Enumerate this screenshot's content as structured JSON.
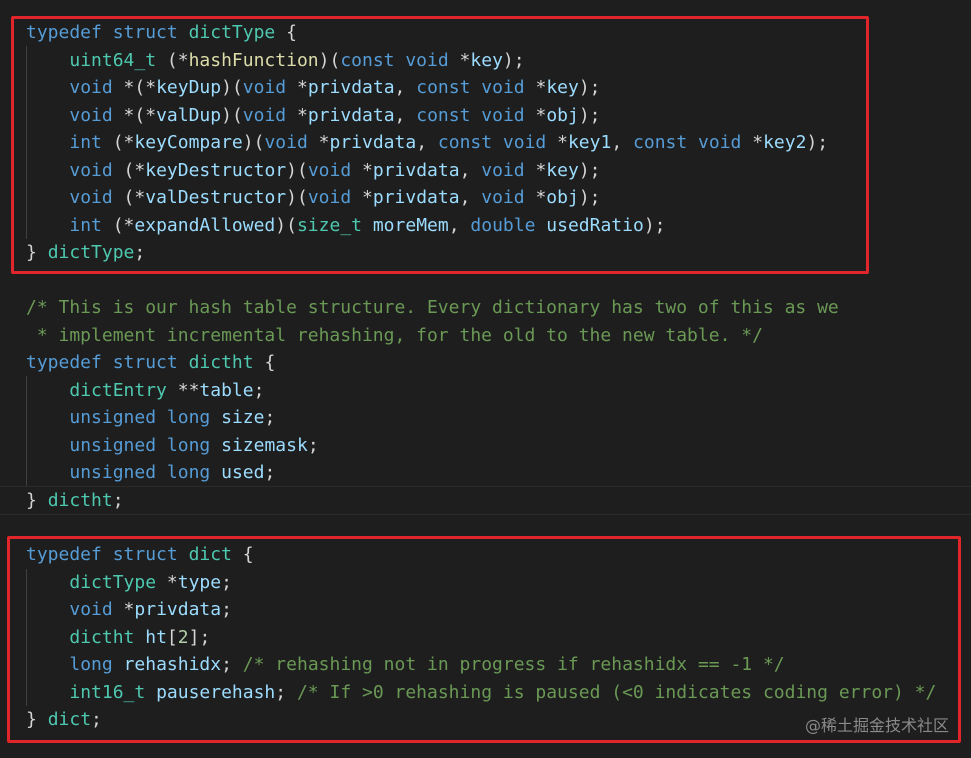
{
  "code": {
    "block1": [
      [
        [
          "kw",
          "typedef"
        ],
        [
          "p",
          " "
        ],
        [
          "kw",
          "struct"
        ],
        [
          "p",
          " "
        ],
        [
          "ty",
          "dictType"
        ],
        [
          "p",
          " {"
        ]
      ],
      [
        [
          "p",
          "    "
        ],
        [
          "ty",
          "uint64_t"
        ],
        [
          "p",
          " (*"
        ],
        [
          "fn",
          "hashFunction"
        ],
        [
          "p",
          ")("
        ],
        [
          "kw",
          "const"
        ],
        [
          "p",
          " "
        ],
        [
          "kw",
          "void"
        ],
        [
          "p",
          " *"
        ],
        [
          "var",
          "key"
        ],
        [
          "p",
          ");"
        ]
      ],
      [
        [
          "p",
          "    "
        ],
        [
          "kw",
          "void"
        ],
        [
          "p",
          " *(*"
        ],
        [
          "var",
          "keyDup"
        ],
        [
          "p",
          ")("
        ],
        [
          "kw",
          "void"
        ],
        [
          "p",
          " *"
        ],
        [
          "var",
          "privdata"
        ],
        [
          "p",
          ", "
        ],
        [
          "kw",
          "const"
        ],
        [
          "p",
          " "
        ],
        [
          "kw",
          "void"
        ],
        [
          "p",
          " *"
        ],
        [
          "var",
          "key"
        ],
        [
          "p",
          ");"
        ]
      ],
      [
        [
          "p",
          "    "
        ],
        [
          "kw",
          "void"
        ],
        [
          "p",
          " *(*"
        ],
        [
          "var",
          "valDup"
        ],
        [
          "p",
          ")("
        ],
        [
          "kw",
          "void"
        ],
        [
          "p",
          " *"
        ],
        [
          "var",
          "privdata"
        ],
        [
          "p",
          ", "
        ],
        [
          "kw",
          "const"
        ],
        [
          "p",
          " "
        ],
        [
          "kw",
          "void"
        ],
        [
          "p",
          " *"
        ],
        [
          "var",
          "obj"
        ],
        [
          "p",
          ");"
        ]
      ],
      [
        [
          "p",
          "    "
        ],
        [
          "kw",
          "int"
        ],
        [
          "p",
          " (*"
        ],
        [
          "var",
          "keyCompare"
        ],
        [
          "p",
          ")("
        ],
        [
          "kw",
          "void"
        ],
        [
          "p",
          " *"
        ],
        [
          "var",
          "privdata"
        ],
        [
          "p",
          ", "
        ],
        [
          "kw",
          "const"
        ],
        [
          "p",
          " "
        ],
        [
          "kw",
          "void"
        ],
        [
          "p",
          " *"
        ],
        [
          "var",
          "key1"
        ],
        [
          "p",
          ", "
        ],
        [
          "kw",
          "const"
        ],
        [
          "p",
          " "
        ],
        [
          "kw",
          "void"
        ],
        [
          "p",
          " *"
        ],
        [
          "var",
          "key2"
        ],
        [
          "p",
          ");"
        ]
      ],
      [
        [
          "p",
          "    "
        ],
        [
          "kw",
          "void"
        ],
        [
          "p",
          " (*"
        ],
        [
          "var",
          "keyDestructor"
        ],
        [
          "p",
          ")("
        ],
        [
          "kw",
          "void"
        ],
        [
          "p",
          " *"
        ],
        [
          "var",
          "privdata"
        ],
        [
          "p",
          ", "
        ],
        [
          "kw",
          "void"
        ],
        [
          "p",
          " *"
        ],
        [
          "var",
          "key"
        ],
        [
          "p",
          ");"
        ]
      ],
      [
        [
          "p",
          "    "
        ],
        [
          "kw",
          "void"
        ],
        [
          "p",
          " (*"
        ],
        [
          "var",
          "valDestructor"
        ],
        [
          "p",
          ")("
        ],
        [
          "kw",
          "void"
        ],
        [
          "p",
          " *"
        ],
        [
          "var",
          "privdata"
        ],
        [
          "p",
          ", "
        ],
        [
          "kw",
          "void"
        ],
        [
          "p",
          " *"
        ],
        [
          "var",
          "obj"
        ],
        [
          "p",
          ");"
        ]
      ],
      [
        [
          "p",
          "    "
        ],
        [
          "kw",
          "int"
        ],
        [
          "p",
          " (*"
        ],
        [
          "var",
          "expandAllowed"
        ],
        [
          "p",
          ")("
        ],
        [
          "ty",
          "size_t"
        ],
        [
          "p",
          " "
        ],
        [
          "var",
          "moreMem"
        ],
        [
          "p",
          ", "
        ],
        [
          "kw",
          "double"
        ],
        [
          "p",
          " "
        ],
        [
          "var",
          "usedRatio"
        ],
        [
          "p",
          ");"
        ]
      ],
      [
        [
          "p",
          "} "
        ],
        [
          "ty",
          "dictType"
        ],
        [
          "p",
          ";"
        ]
      ]
    ],
    "block2": [
      [
        [
          "cm",
          "/* This is our hash table structure. Every dictionary has two of this as we"
        ]
      ],
      [
        [
          "cm",
          " * implement incremental rehashing, for the old to the new table. */"
        ]
      ],
      [
        [
          "kw",
          "typedef"
        ],
        [
          "p",
          " "
        ],
        [
          "kw",
          "struct"
        ],
        [
          "p",
          " "
        ],
        [
          "ty",
          "dictht"
        ],
        [
          "p",
          " {"
        ]
      ],
      [
        [
          "p",
          "    "
        ],
        [
          "ty",
          "dictEntry"
        ],
        [
          "p",
          " **"
        ],
        [
          "var",
          "table"
        ],
        [
          "p",
          ";"
        ]
      ],
      [
        [
          "p",
          "    "
        ],
        [
          "kw",
          "unsigned"
        ],
        [
          "p",
          " "
        ],
        [
          "kw",
          "long"
        ],
        [
          "p",
          " "
        ],
        [
          "var",
          "size"
        ],
        [
          "p",
          ";"
        ]
      ],
      [
        [
          "p",
          "    "
        ],
        [
          "kw",
          "unsigned"
        ],
        [
          "p",
          " "
        ],
        [
          "kw",
          "long"
        ],
        [
          "p",
          " "
        ],
        [
          "var",
          "sizemask"
        ],
        [
          "p",
          ";"
        ]
      ],
      [
        [
          "p",
          "    "
        ],
        [
          "kw",
          "unsigned"
        ],
        [
          "p",
          " "
        ],
        [
          "kw",
          "long"
        ],
        [
          "p",
          " "
        ],
        [
          "var",
          "used"
        ],
        [
          "p",
          ";"
        ]
      ],
      [
        [
          "p",
          "} "
        ],
        [
          "ty",
          "dictht"
        ],
        [
          "p",
          ";"
        ]
      ]
    ],
    "block3": [
      [
        [
          "kw",
          "typedef"
        ],
        [
          "p",
          " "
        ],
        [
          "kw",
          "struct"
        ],
        [
          "p",
          " "
        ],
        [
          "ty",
          "dict"
        ],
        [
          "p",
          " {"
        ]
      ],
      [
        [
          "p",
          "    "
        ],
        [
          "ty",
          "dictType"
        ],
        [
          "p",
          " *"
        ],
        [
          "var",
          "type"
        ],
        [
          "p",
          ";"
        ]
      ],
      [
        [
          "p",
          "    "
        ],
        [
          "kw",
          "void"
        ],
        [
          "p",
          " *"
        ],
        [
          "var",
          "privdata"
        ],
        [
          "p",
          ";"
        ]
      ],
      [
        [
          "p",
          "    "
        ],
        [
          "ty",
          "dictht"
        ],
        [
          "p",
          " "
        ],
        [
          "var",
          "ht"
        ],
        [
          "p",
          "["
        ],
        [
          "num",
          "2"
        ],
        [
          "p",
          "];"
        ]
      ],
      [
        [
          "p",
          "    "
        ],
        [
          "kw",
          "long"
        ],
        [
          "p",
          " "
        ],
        [
          "var",
          "rehashidx"
        ],
        [
          "p",
          "; "
        ],
        [
          "cm",
          "/* rehashing not in progress if rehashidx == -1 */"
        ]
      ],
      [
        [
          "p",
          "    "
        ],
        [
          "ty",
          "int16_t"
        ],
        [
          "p",
          " "
        ],
        [
          "var",
          "pauserehash"
        ],
        [
          "p",
          "; "
        ],
        [
          "cm",
          "/* If >0 rehashing is paused (<0 indicates coding error) */"
        ]
      ],
      [
        [
          "p",
          "} "
        ],
        [
          "ty",
          "dict"
        ],
        [
          "p",
          ";"
        ]
      ]
    ]
  },
  "watermark": "@稀土掘金技术社区",
  "colors": {
    "background": "#1e1e1e",
    "keyword": "#569cd6",
    "type": "#4ec9b0",
    "function": "#dcdcaa",
    "variable": "#9cdcfe",
    "comment": "#6a9955",
    "number": "#b5cea8",
    "highlight_box": "#e0252b"
  }
}
